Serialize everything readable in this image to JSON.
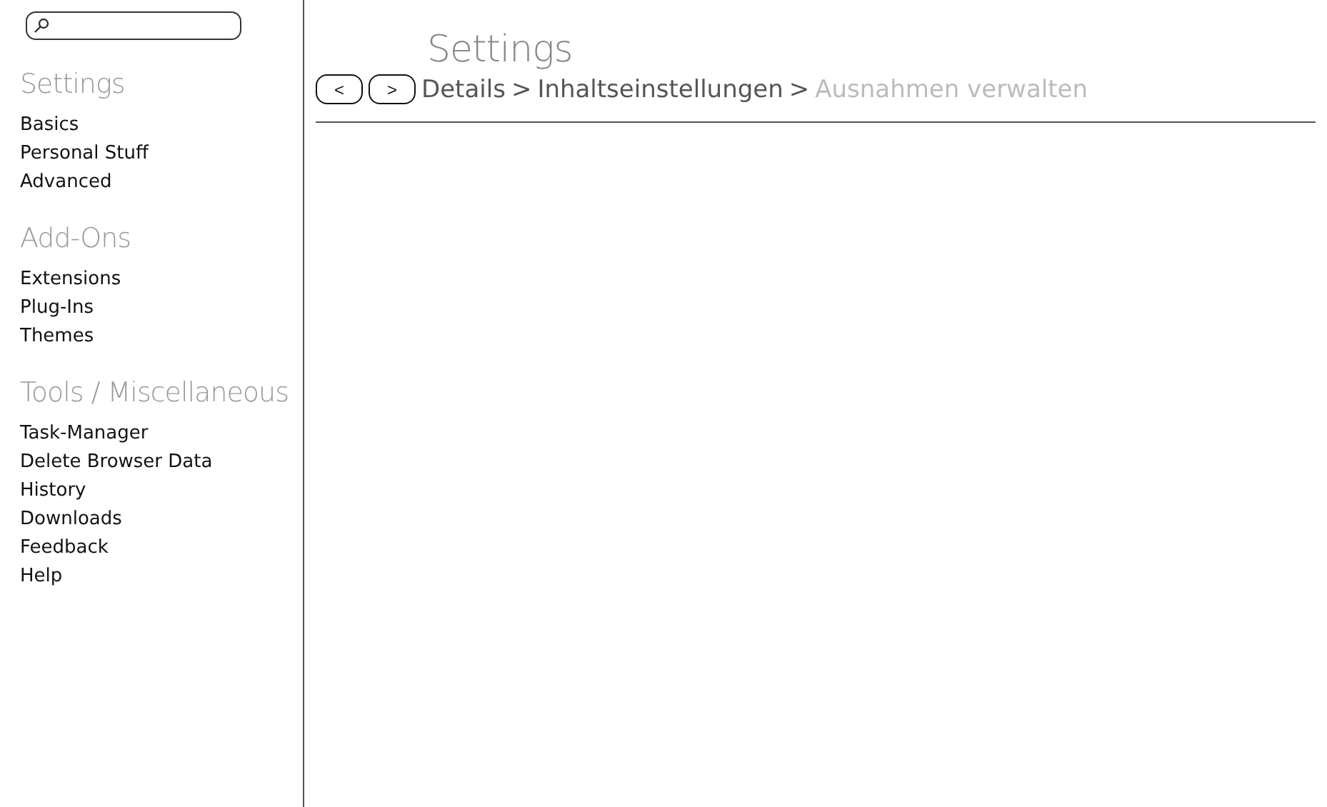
{
  "sidebar": {
    "sections": [
      {
        "title": "Settings",
        "items": [
          "Basics",
          "Personal Stuff",
          "Advanced"
        ]
      },
      {
        "title": "Add-Ons",
        "items": [
          "Extensions",
          "Plug-Ins",
          "Themes"
        ]
      },
      {
        "title": "Tools / Miscellaneous",
        "items": [
          "Task-Manager",
          "Delete Browser Data",
          "History",
          "Downloads",
          "Feedback",
          "Help"
        ]
      }
    ]
  },
  "header": {
    "title": "Settings",
    "back_button": "<",
    "forward_button": ">",
    "breadcrumb": [
      {
        "label": "Details",
        "current": false
      },
      {
        "label": "Inhaltseinstellungen",
        "current": false
      },
      {
        "label": "Ausnahmen verwalten",
        "current": true
      }
    ],
    "separator": ">"
  }
}
